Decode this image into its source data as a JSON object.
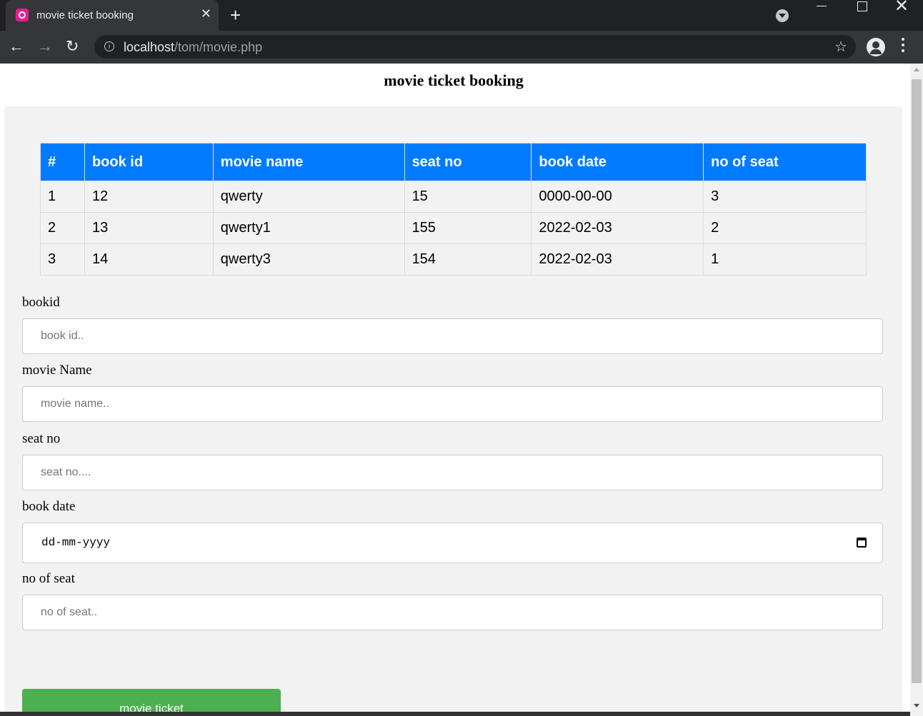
{
  "browser": {
    "tab_title": "movie ticket booking",
    "new_tab": "+",
    "close": "✕",
    "url_host": "localhost",
    "url_path": "/tom/movie.php",
    "back": "←",
    "forward": "→",
    "reload": "↻",
    "star": "☆",
    "info": "i"
  },
  "page": {
    "heading": "movie ticket booking"
  },
  "table": {
    "headers": [
      "#",
      "book id",
      "movie name",
      "seat no",
      "book date",
      "no of seat"
    ],
    "rows": [
      [
        "1",
        "12",
        "qwerty",
        "15",
        "0000-00-00",
        "3"
      ],
      [
        "2",
        "13",
        "qwerty1",
        "155",
        "2022-02-03",
        "2"
      ],
      [
        "3",
        "14",
        "qwerty3",
        "154",
        "2022-02-03",
        "1"
      ]
    ]
  },
  "form": {
    "bookid_label": "bookid",
    "bookid_placeholder": "book id..",
    "movie_label": "movie Name",
    "movie_placeholder": "movie name..",
    "seat_label": "seat no",
    "seat_placeholder": "seat no....",
    "date_label": "book date",
    "date_placeholder": "dd-mm-yyyy",
    "count_label": "no of seat",
    "count_placeholder": "no of seat..",
    "submit_label": "movie ticket"
  },
  "colors": {
    "table_header": "#007bff",
    "submit_button": "#4caf50"
  }
}
